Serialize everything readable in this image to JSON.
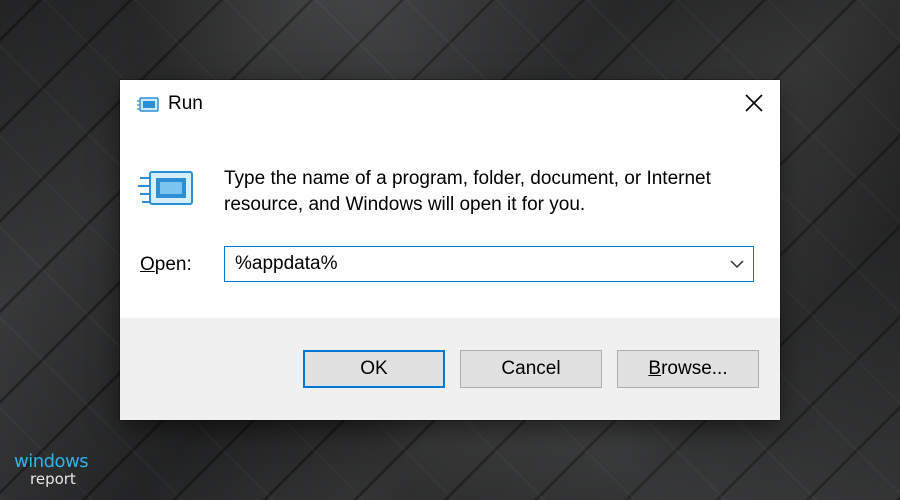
{
  "dialog": {
    "title": "Run",
    "close_icon": "close-icon",
    "description": "Type the name of a program, folder, document, or Internet resource, and Windows will open it for you.",
    "open_label_underlined": "O",
    "open_label_rest": "pen:",
    "open_value": "%appdata%",
    "buttons": {
      "ok": "OK",
      "cancel": "Cancel",
      "browse_underlined": "B",
      "browse_rest": "rowse..."
    }
  },
  "watermark": {
    "line1": "windows",
    "line2": "report"
  },
  "colors": {
    "accent": "#0078d7",
    "footer_bg": "#f0f0f0",
    "button_bg": "#e1e1e1",
    "watermark_blue": "#2fb3e8"
  }
}
